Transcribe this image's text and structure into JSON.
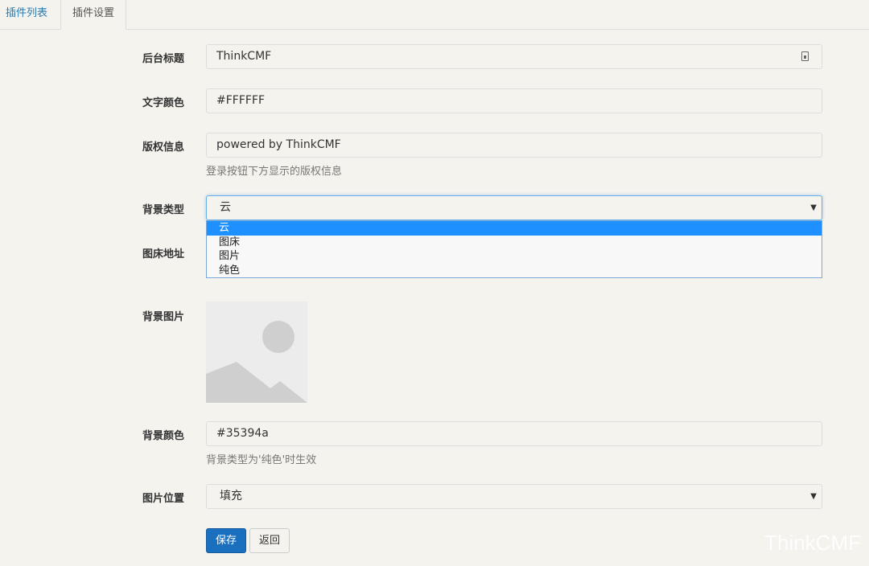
{
  "tabs": [
    {
      "label": "插件列表"
    },
    {
      "label": "插件设置"
    }
  ],
  "form": {
    "admin_title": {
      "label": "后台标题",
      "value": "ThinkCMF"
    },
    "text_color": {
      "label": "文字颜色",
      "value": "#FFFFFF"
    },
    "copyright": {
      "label": "版权信息",
      "value": "powered by ThinkCMF",
      "help": "登录按钮下方显示的版权信息"
    },
    "bg_type": {
      "label": "背景类型",
      "value": "云",
      "options": [
        "云",
        "图床",
        "图片",
        "纯色"
      ]
    },
    "image_host": {
      "label": "图床地址"
    },
    "bg_image": {
      "label": "背景图片"
    },
    "bg_color": {
      "label": "背景颜色",
      "value": "#35394a",
      "help": "背景类型为'纯色'时生效"
    },
    "image_position": {
      "label": "图片位置",
      "value": "填充"
    }
  },
  "buttons": {
    "save": "保存",
    "back": "返回"
  },
  "watermark": "ThinkCMF",
  "colors": {
    "accent": "#1a6fbf",
    "selected_option": "#1e90ff",
    "background": "#f5f3ee"
  }
}
